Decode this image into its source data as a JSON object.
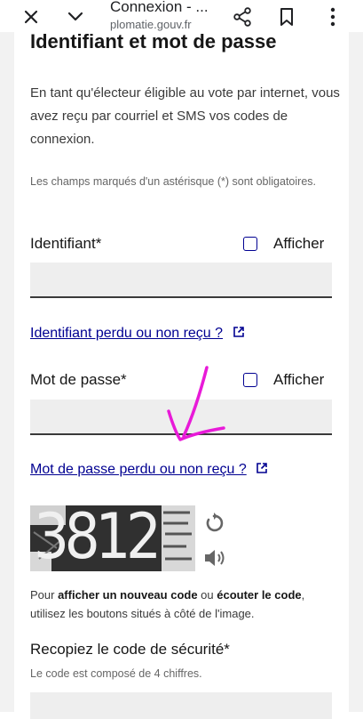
{
  "browser": {
    "title": "Connexion - ...",
    "url": "plomatie.gouv.fr",
    "icons": [
      "close-icon",
      "chevron-down-icon",
      "share-icon",
      "bookmark-icon",
      "more-vertical-icon"
    ]
  },
  "form": {
    "heading": "Identifiant et mot de passe",
    "intro": "En tant qu'électeur éligible au vote par internet, vous avez reçu par courriel et SMS vos codes de connexion.",
    "required_note": "Les champs marqués d'un astérisque (*) sont obligatoires.",
    "identifier": {
      "label": "Identifiant*",
      "show_label": "Afficher",
      "value": "",
      "lost_link": "Identifiant perdu ou non reçu ?"
    },
    "password": {
      "label": "Mot de passe*",
      "show_label": "Afficher",
      "value": "",
      "lost_link": "Mot de passe perdu ou non reçu ?"
    },
    "captcha": {
      "image_text": "3812",
      "help_pre": "Pour ",
      "help_b1": "afficher un nouveau code",
      "help_mid": " ou ",
      "help_b2": "écouter le code",
      "help_post": ", utilisez les boutons situés à côté de l'image.",
      "refresh_icon": "refresh-icon",
      "audio_icon": "speaker-icon"
    },
    "security_code": {
      "label": "Recopiez le code de sécurité*",
      "hint": "Le code est composé de 4 chiffres.",
      "value": ""
    }
  },
  "colors": {
    "link": "#000091",
    "annotation": "#e81ad8",
    "page_bg": "#f2f2f2",
    "field_bg": "#eeeeee"
  }
}
